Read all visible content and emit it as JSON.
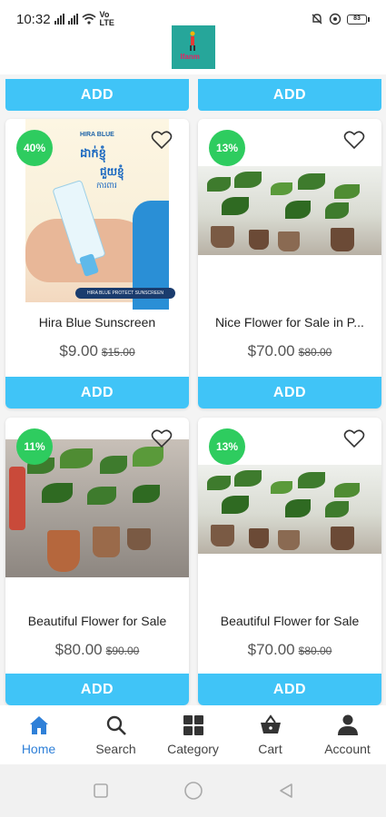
{
  "status_bar": {
    "time": "10:32",
    "battery": "83"
  },
  "logo": {
    "text": "Ifanm"
  },
  "add_label": "ADD",
  "products": [
    {
      "title": "Hira Blue Sunscreen",
      "discount": "40%",
      "price": "$9.00",
      "old_price": "$15.00",
      "image": {
        "brand": "HIRA BLUE",
        "tagline": "HIRA BLUE PROTECT SUNSCREEN",
        "khmer": [
          "ដាក់ខ្ញុំ",
          "ជួយខ្ញុំ",
          "ការពារ"
        ]
      }
    },
    {
      "title": "Nice Flower for Sale in P...",
      "discount": "13%",
      "price": "$70.00",
      "old_price": "$80.00"
    },
    {
      "title": "Beautiful Flower for Sale",
      "discount": "11%",
      "price": "$80.00",
      "old_price": "$90.00"
    },
    {
      "title": "Beautiful Flower for Sale",
      "discount": "13%",
      "price": "$70.00",
      "old_price": "$80.00"
    }
  ],
  "nav": [
    {
      "label": "Home",
      "icon": "home-icon",
      "active": true
    },
    {
      "label": "Search",
      "icon": "search-icon"
    },
    {
      "label": "Category",
      "icon": "grid-icon"
    },
    {
      "label": "Cart",
      "icon": "basket-icon"
    },
    {
      "label": "Account",
      "icon": "person-icon"
    }
  ],
  "colors": {
    "accent": "#40c4f7",
    "badge": "#2ecc5f",
    "nav_active": "#2f80d8"
  }
}
